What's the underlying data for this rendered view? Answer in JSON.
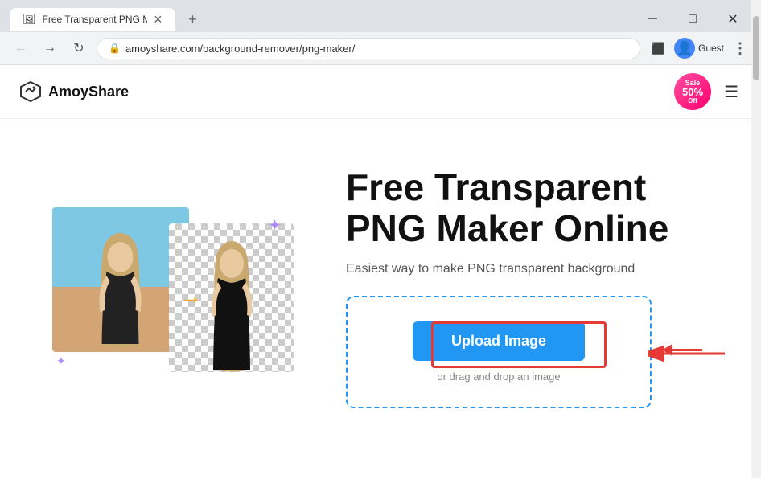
{
  "browser": {
    "tab_title": "Free Transparent PNG Maker -",
    "tab_favicon": "🖼",
    "new_tab_label": "+",
    "address": "amoyshare.com/background-remover/png-maker/",
    "profile_label": "Guest",
    "window_controls": {
      "minimize": "─",
      "maximize": "□",
      "close": "✕"
    }
  },
  "header": {
    "logo_text": "AmoyShare",
    "sale_badge": {
      "sale": "Sale",
      "percent": "50%",
      "off": "Off"
    },
    "menu_label": "☰"
  },
  "hero": {
    "title": "Free Transparent PNG Maker Online",
    "subtitle": "Easiest way to make PNG transparent background",
    "upload_button": "Upload Image",
    "upload_hint": "or drag and drop an image"
  },
  "icons": {
    "back": "←",
    "forward": "→",
    "refresh": "↻",
    "lock": "🔒",
    "cast": "⬛",
    "profile": "👤",
    "more": "⋮",
    "arrow": "→",
    "sparkle": "✦"
  }
}
